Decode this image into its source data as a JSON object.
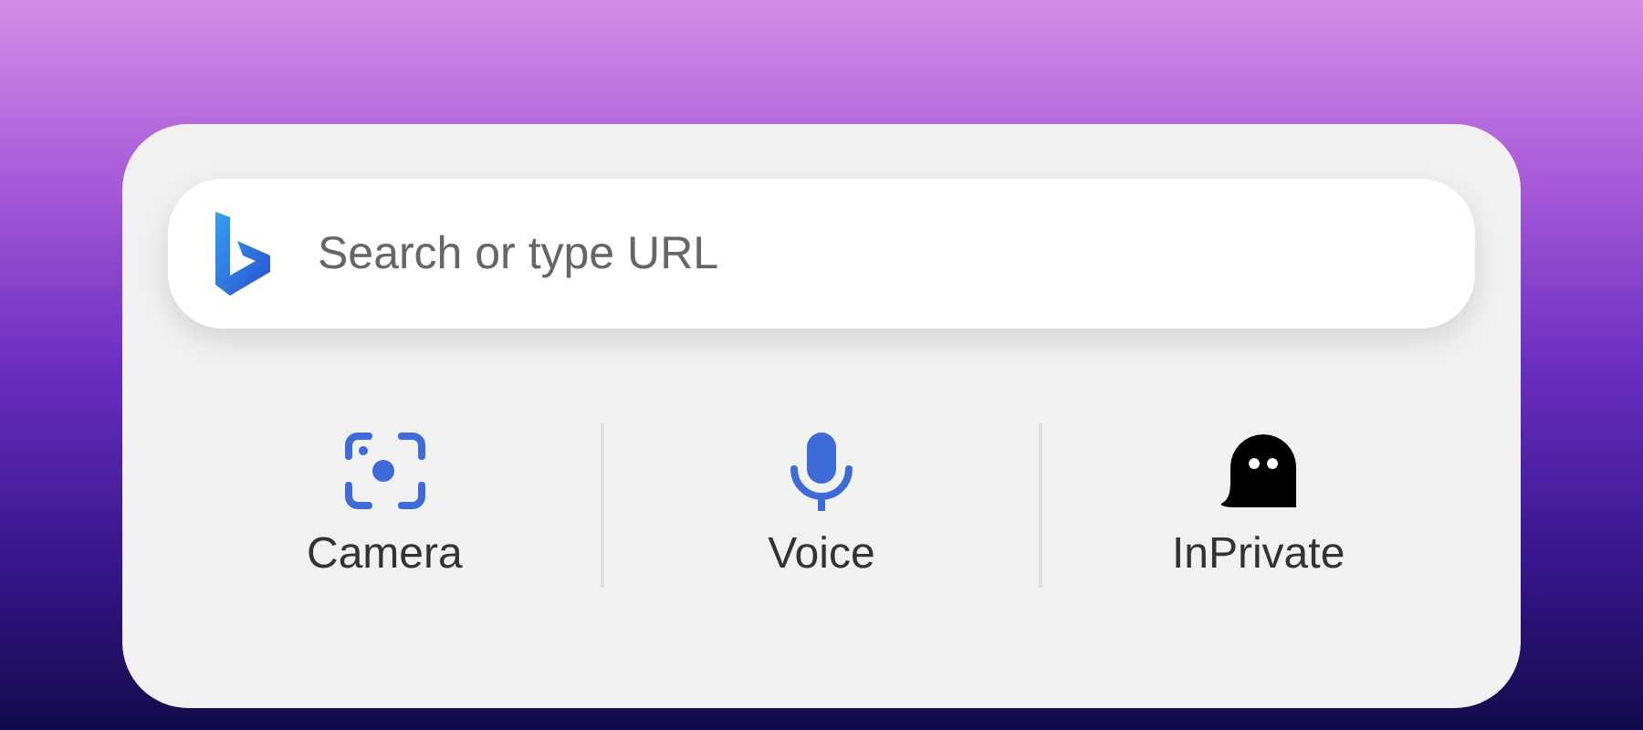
{
  "search": {
    "placeholder": "Search or type URL"
  },
  "actions": [
    {
      "label": "Camera",
      "kind": "camera"
    },
    {
      "label": "Voice",
      "kind": "voice"
    },
    {
      "label": "InPrivate",
      "kind": "ghost"
    }
  ]
}
